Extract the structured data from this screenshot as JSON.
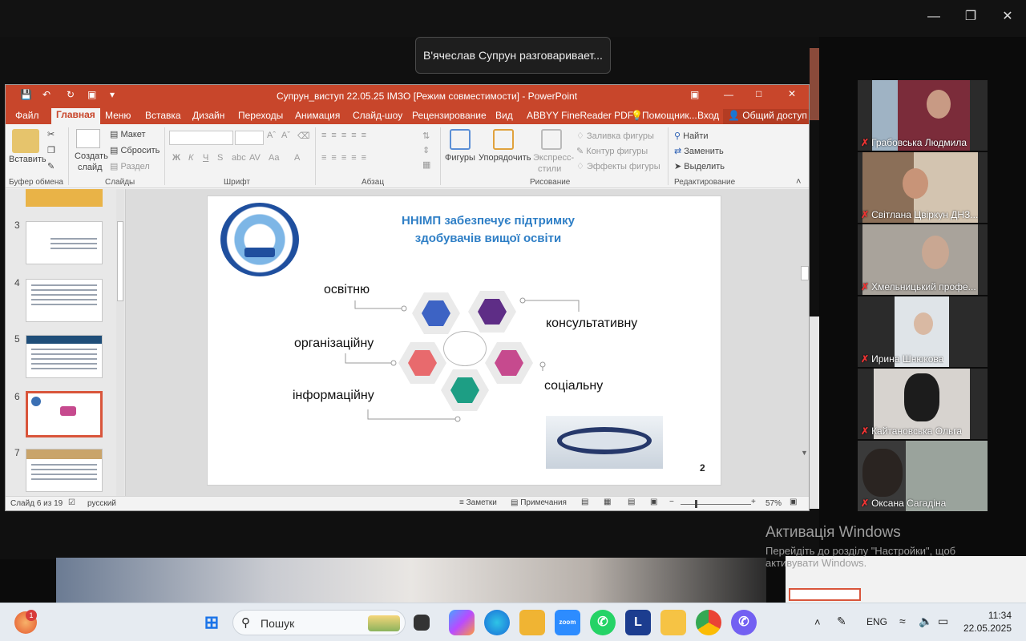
{
  "speaker_toast": "В'ячеслав Супрун разговаривает...",
  "ppt": {
    "title": "Супрун_виступ 22.05.25 ІМЗО [Режим совместимости] - PowerPoint",
    "tabs": [
      "Файл",
      "Главная",
      "Меню",
      "Вставка",
      "Дизайн",
      "Переходы",
      "Анимация",
      "Слайд-шоу",
      "Рецензирование",
      "Вид",
      "ABBYY FineReader PDF",
      "Помощник...",
      "Вход",
      "Общий доступ"
    ],
    "ribbon": {
      "paste": "Вставить",
      "create_slide_1": "Создать",
      "create_slide_2": "слайд",
      "layout": "Макет",
      "reset": "Сбросить",
      "section": "Раздел",
      "shapes": "Фигуры",
      "arrange": "Упорядочить",
      "express_1": "Экспресс-",
      "express_2": "стили",
      "fill": "Заливка фигуры",
      "outline": "Контур фигуры",
      "effects": "Эффекты фигуры",
      "find": "Найти",
      "replace": "Заменить",
      "select": "Выделить",
      "groups": {
        "clipboard": "Буфер обмена",
        "slides": "Слайды",
        "font": "Шрифт",
        "paragraph": "Абзац",
        "drawing": "Рисование",
        "editing": "Редактирование"
      }
    },
    "thumbs": [
      "3",
      "4",
      "5",
      "6",
      "7"
    ],
    "slide": {
      "title_line1": "ННІМП забезпечує підтримку",
      "title_line2": "здобувачів вищої освіти",
      "labels": [
        "освітню",
        "консультативну",
        "організаційну",
        "соціальну",
        "інформаційну"
      ],
      "page_number": "2",
      "hex_colors": {
        "blue": "#3d63c4",
        "purple": "#5e2d86",
        "red": "#e86a6d",
        "pink": "#c64a8e",
        "teal": "#1d9e84"
      }
    },
    "status": {
      "slide_info": "Слайд 6 из 19",
      "language": "русский",
      "notes": "Заметки",
      "comments": "Примечания",
      "zoom": "57%"
    }
  },
  "participants": [
    {
      "name": "Грабовська Людмила"
    },
    {
      "name": "Світлана Цвіркун ДНЗ..."
    },
    {
      "name": "Хмельницький профе..."
    },
    {
      "name": "Ирина Шнюкова"
    },
    {
      "name": "Кайтановська Ольга"
    },
    {
      "name": "Оксана Сагадіна"
    }
  ],
  "watermark": {
    "line1": "Активація Windows",
    "line2": "Перейдіть до розділу \"Настройки\", щоб активувати Windows."
  },
  "taskbar": {
    "search_placeholder": "Пошук",
    "badge": "1",
    "lang": "ENG",
    "time": "11:34",
    "date": "22.05.2025"
  }
}
